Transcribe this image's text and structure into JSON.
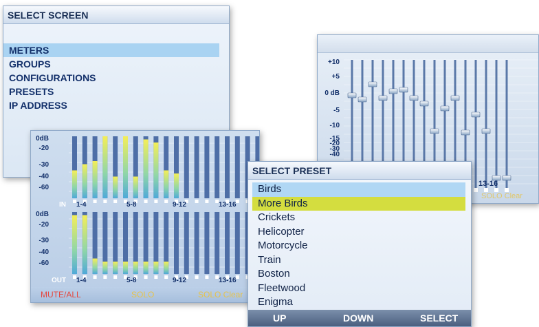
{
  "select_screen": {
    "title": "SELECT SCREEN",
    "items": [
      "METERS",
      "GROUPS",
      "CONFIGURATIONS",
      "PRESETS",
      "IP ADDRESS"
    ],
    "selected_index": 0
  },
  "eq_screen": {
    "scale": [
      "+10",
      "+5",
      "0 dB",
      "-5",
      "-10",
      "-15",
      "-20",
      "-30",
      "-40"
    ],
    "group_label": "13-16",
    "footer_hint": "SOLO Clear"
  },
  "meters_screen": {
    "scale": [
      "0dB",
      "-20",
      "-30",
      "-40",
      "-60"
    ],
    "in_label": "IN",
    "out_label": "OUT",
    "groups": [
      "1-4",
      "5-8",
      "9-12",
      "13-16"
    ],
    "footer": [
      "MUTE/ALL",
      "SOLO",
      "SOLO Clear"
    ]
  },
  "preset_screen": {
    "title": "SELECT PRESET",
    "items": [
      "Birds",
      "More Birds",
      "Crickets",
      "Helicopter",
      "Motorcycle",
      "Train",
      "Boston",
      "Fleetwood",
      "Enigma"
    ],
    "blue_index": 0,
    "yellow_index": 1,
    "buttons": [
      "UP",
      "DOWN",
      "SELECT"
    ]
  },
  "colors": {
    "accent_blue": "#a9d3f2",
    "accent_yellow": "#d4dd3f",
    "mute_red": "#e4483f",
    "solo_yellow": "#e6c34a"
  }
}
